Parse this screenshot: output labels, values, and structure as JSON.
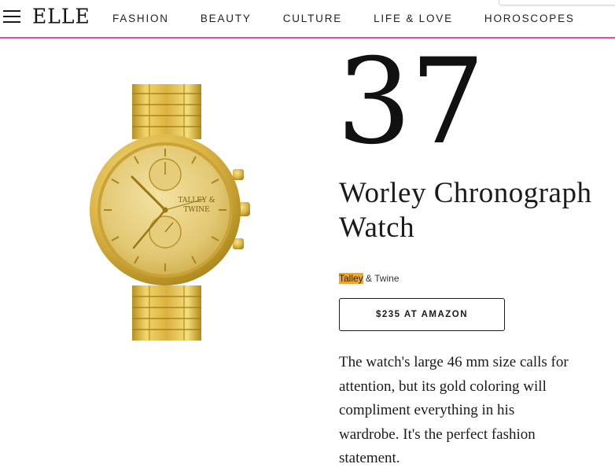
{
  "header": {
    "logo": "ELLE",
    "nav": [
      {
        "label": "FASHION"
      },
      {
        "label": "BEAUTY"
      },
      {
        "label": "CULTURE"
      },
      {
        "label": "LIFE & LOVE"
      },
      {
        "label": "HOROSCOPES"
      }
    ],
    "accent_color": "#e24fa0"
  },
  "product": {
    "rank": "37",
    "title": "Worley Chronograph Watch",
    "brand_highlight": "Talley",
    "brand_rest": " & Twine",
    "buy_label": "$235 AT AMAZON",
    "description": "The watch's large 46 mm size calls for attention, but its gold coloring will compliment everything in his wardrobe. It's the perfect fashion statement.",
    "dial_text_line1": "TALLEY &",
    "dial_text_line2": "TWINE",
    "highlight_color": "#f5a623"
  }
}
